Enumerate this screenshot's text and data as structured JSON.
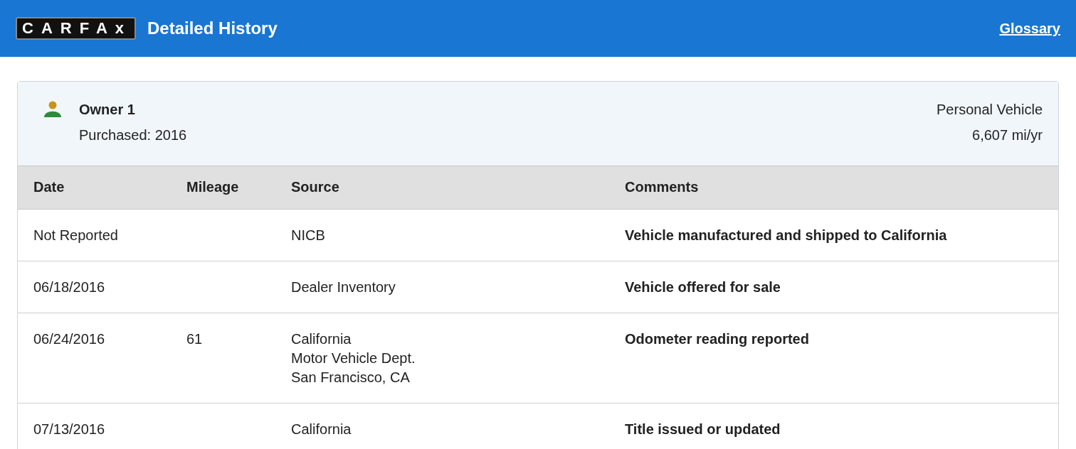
{
  "header": {
    "logo": "CARFAx",
    "title": "Detailed History",
    "link": "Glossary"
  },
  "owner": {
    "name": "Owner 1",
    "purchased": "Purchased: 2016",
    "usage": "Personal Vehicle",
    "rate": "6,607 mi/yr"
  },
  "table": {
    "columns": [
      "Date",
      "Mileage",
      "Source",
      "Comments"
    ],
    "rows": [
      {
        "date": "Not Reported",
        "mileage": "",
        "source": [
          "NICB"
        ],
        "comment": "Vehicle manufactured and shipped to California",
        "details": []
      },
      {
        "date": "06/18/2016",
        "mileage": "",
        "source": [
          "Dealer Inventory"
        ],
        "comment": "Vehicle offered for sale",
        "details": []
      },
      {
        "date": "06/24/2016",
        "mileage": "61",
        "source": [
          "California",
          "Motor Vehicle Dept.",
          "San Francisco, CA"
        ],
        "comment": "Odometer reading reported",
        "details": []
      },
      {
        "date": "07/13/2016",
        "mileage": "",
        "source": [
          "California"
        ],
        "comment": "Title issued or updated",
        "details": []
      }
    ]
  }
}
